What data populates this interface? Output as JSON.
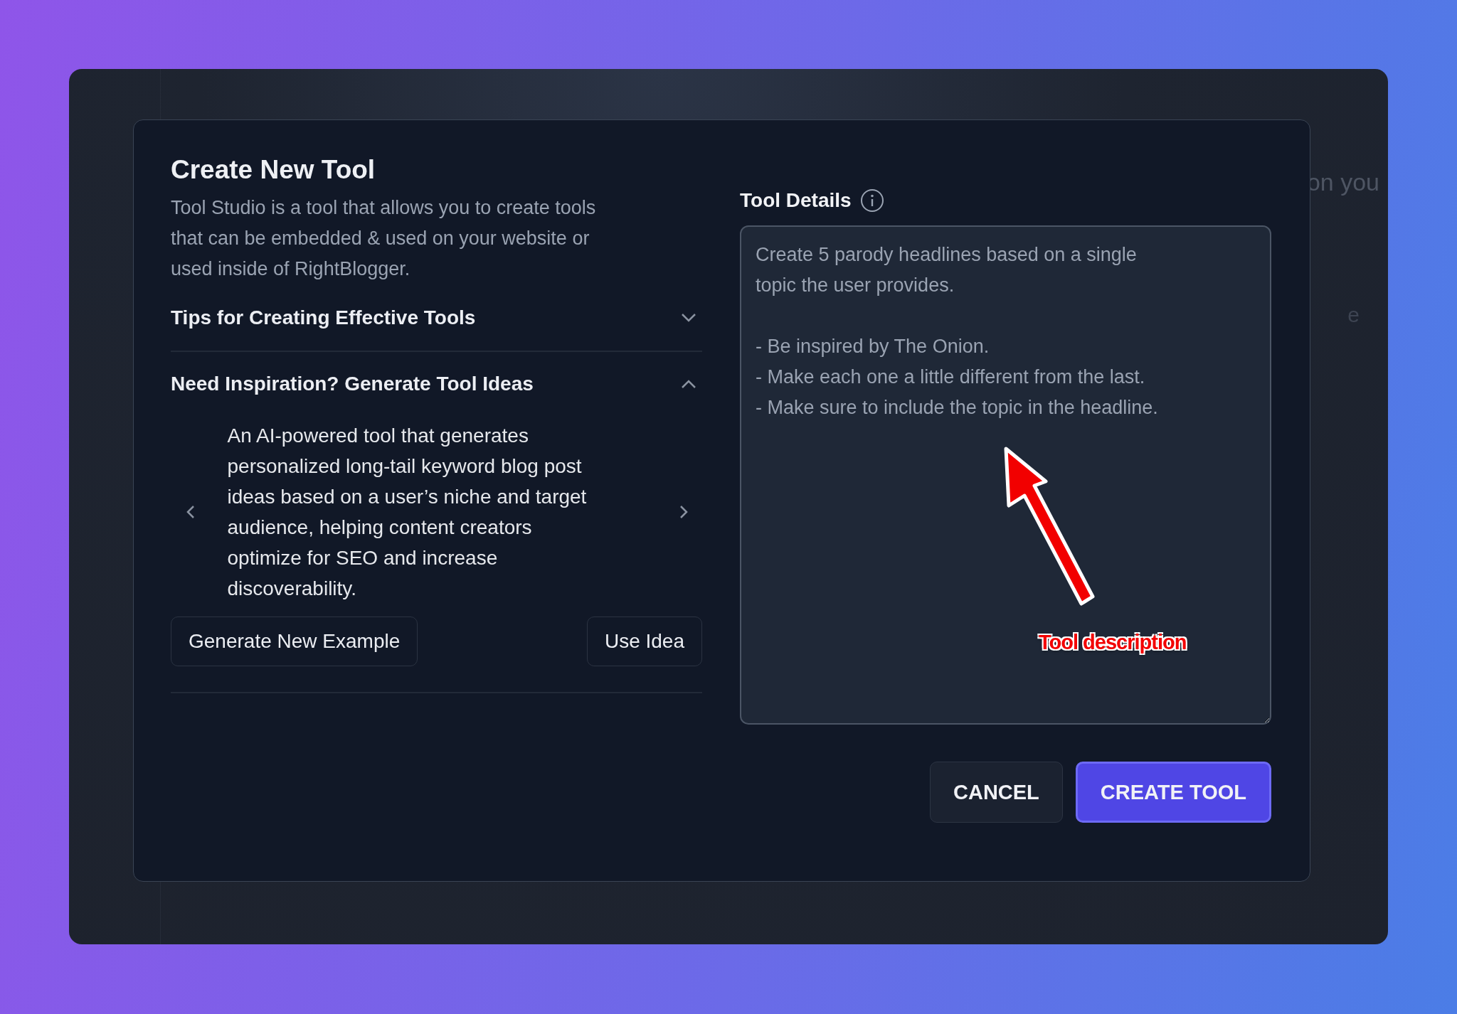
{
  "background": {
    "heading_fragment": "on you",
    "row_fragment": "e"
  },
  "dialog": {
    "title": "Create New Tool",
    "description": "Tool Studio is a tool that allows you to create tools\nthat can be embedded & used on your website or\nused inside of RightBlogger.",
    "sections": [
      {
        "title": "Tips for Creating Effective Tools",
        "expanded": false
      },
      {
        "title": "Need Inspiration? Generate Tool Ideas",
        "expanded": true,
        "idea": "An AI-powered tool that generates\npersonalized long-tail keyword blog post\nideas based on a user’s niche and target\naudience, helping content creators\noptimize for SEO and increase\ndiscoverability.",
        "buttons": [
          "Generate New Example",
          "Use Idea"
        ]
      }
    ]
  },
  "details": {
    "label": "Tool Details",
    "value": "Create 5 parody headlines based on a single\ntopic the user provides.\n\n- Be inspired by The Onion.\n- Make each one a little different from the last.\n- Make sure to include the topic in the headline.",
    "annotation": "Tool description"
  },
  "actions": [
    {
      "label": "CANCEL",
      "kind": "secondary"
    },
    {
      "label": "CREATE TOOL",
      "kind": "primary"
    }
  ]
}
